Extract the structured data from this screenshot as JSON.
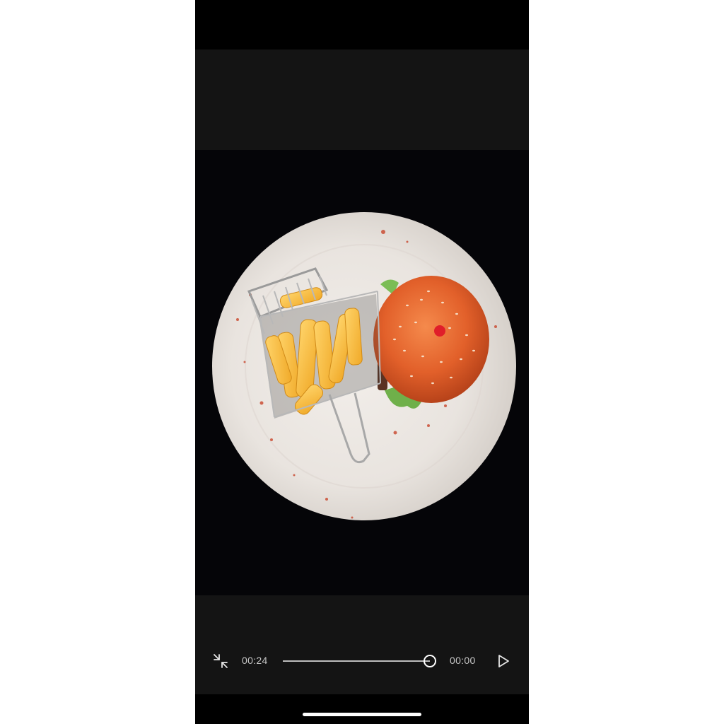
{
  "player": {
    "current_time": "00:24",
    "end_time": "00:00",
    "progress": 1.0,
    "accent": "#ffffff"
  },
  "icons": {
    "minimize": "collapse-arrows-icon",
    "play": "play-icon"
  },
  "colors": {
    "background": "#000000",
    "control_bar": "#141414",
    "text": "#c8c8c8"
  }
}
